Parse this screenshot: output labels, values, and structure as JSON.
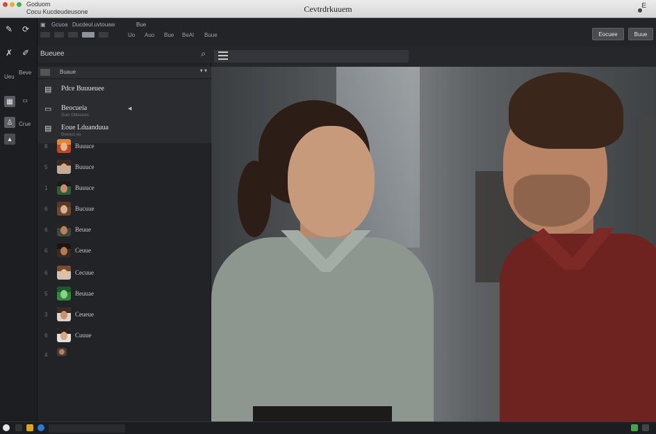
{
  "window": {
    "title": "Cevtrdrkuuem",
    "path_line1": "Goduom",
    "path_line2": "Cocu Kucdeudeusone",
    "right_label": "E"
  },
  "menu": {
    "items": [
      "Gcuoa",
      "Ducdeul.uvtouaw",
      "Bue"
    ],
    "sub_items": [
      "Uo",
      "Auo",
      "Bue",
      "BeAl",
      "Buue"
    ],
    "buttons": [
      "Eocuee",
      "Buue"
    ]
  },
  "rail": {
    "labels": [
      "Ueu",
      "Beve",
      "Crue"
    ],
    "icons": [
      "brush-icon",
      "cursor-icon",
      "pen-icon",
      "folder-icon",
      "layers-icon",
      "user-icon",
      "grid-icon"
    ]
  },
  "panel": {
    "title": "Bueuee",
    "sub_label": "Buaue",
    "upper": [
      {
        "icon": "document-icon",
        "label": "Pdce Buuueuee",
        "sub": ""
      },
      {
        "icon": "chat-icon",
        "label": "Beocueia",
        "sub": "Guis Gbleuues"
      },
      {
        "icon": "list-icon",
        "label": "Eoue Lduanduua",
        "sub": "Boeuus eu"
      }
    ],
    "characters": [
      {
        "num": "8",
        "name": "Buuuce"
      },
      {
        "num": "5",
        "name": "Buuuce"
      },
      {
        "num": "1",
        "name": "Buuuce"
      },
      {
        "num": "6",
        "name": "Bucuue"
      },
      {
        "num": "6",
        "name": "Beuue"
      },
      {
        "num": "6",
        "name": "Ceuue"
      },
      {
        "num": "6",
        "name": "Cecuue"
      },
      {
        "num": "5",
        "name": "Beuuae"
      },
      {
        "num": "3",
        "name": "Ceueue"
      },
      {
        "num": "6",
        "name": "Cuuue"
      },
      {
        "num": "4",
        "name": ""
      }
    ]
  },
  "colors": {
    "accent": "#8e9499",
    "panel_bg": "#222326",
    "shirt_woman": "#8d9790",
    "shirt_man": "#6e2321"
  }
}
